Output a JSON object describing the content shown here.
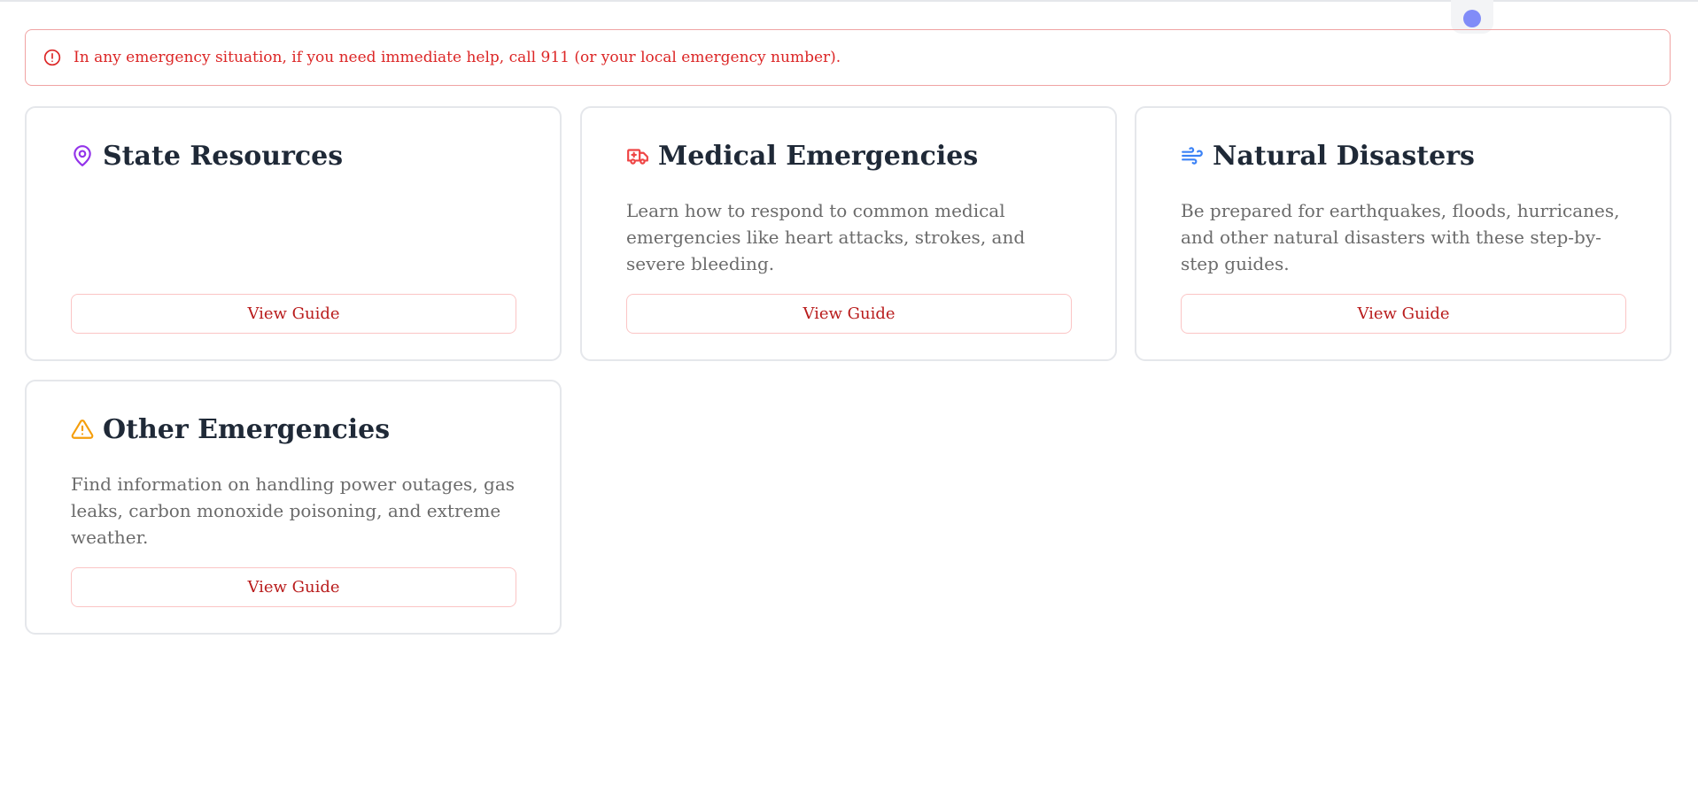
{
  "alert": {
    "text": "In any emergency situation, if you need immediate help, call 911 (or your local emergency number).",
    "icon": "alert-circle-icon",
    "color": "#dc2626"
  },
  "cards": [
    {
      "title": "State Resources",
      "icon": "map-pin-icon",
      "icon_color": "#9333ea",
      "description": "",
      "button_label": "View Guide"
    },
    {
      "title": "Medical Emergencies",
      "icon": "ambulance-icon",
      "icon_color": "#ef4444",
      "description": "Learn how to respond to common medical emergencies like heart attacks, strokes, and severe bleeding.",
      "button_label": "View Guide"
    },
    {
      "title": "Natural Disasters",
      "icon": "wind-icon",
      "icon_color": "#3b82f6",
      "description": "Be prepared for earthquakes, floods, hurricanes, and other natural disasters with these step-by-step guides.",
      "button_label": "View Guide"
    },
    {
      "title": "Other Emergencies",
      "icon": "warning-triangle-icon",
      "icon_color": "#f59e0b",
      "description": "Find information on handling power outages, gas leaks, carbon monoxide poisoning, and extreme weather.",
      "button_label": "View Guide"
    }
  ]
}
